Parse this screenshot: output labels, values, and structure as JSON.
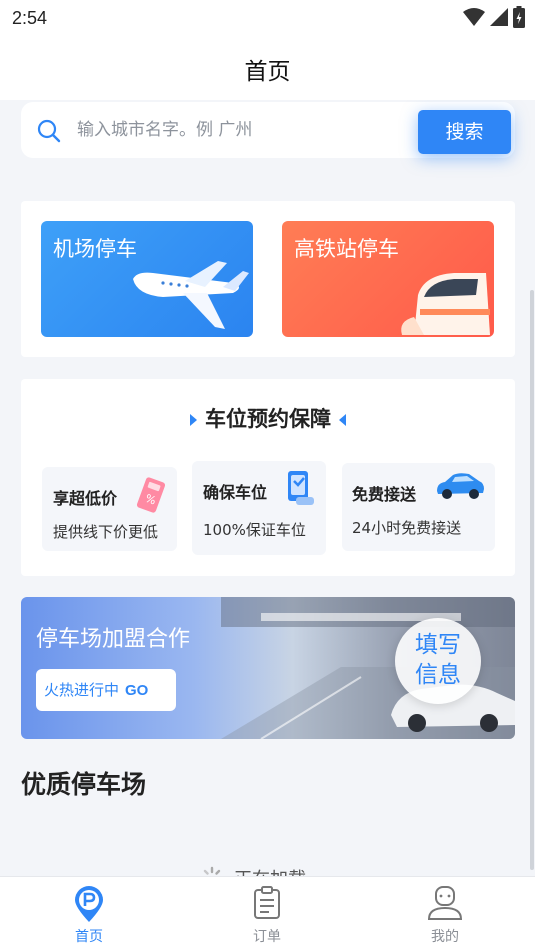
{
  "status_bar": {
    "time": "2:54",
    "icons": [
      "wifi-icon",
      "signal-icon",
      "battery-icon"
    ]
  },
  "header": {
    "title": "首页"
  },
  "search": {
    "placeholder": "输入城市名字。例 广州",
    "button_label": "搜索"
  },
  "services": [
    {
      "label": "机场停车",
      "icon": "airplane-icon",
      "color": "#2f86f6"
    },
    {
      "label": "高铁站停车",
      "icon": "train-icon",
      "color": "#ff6a4f"
    }
  ],
  "promise": {
    "title": "车位预约保障",
    "features": [
      {
        "title": "享超低价",
        "desc": "提供线下价更低",
        "icon": "discount-ticket-icon"
      },
      {
        "title": "确保车位",
        "desc": "100%保证车位",
        "icon": "parking-guarantee-icon"
      },
      {
        "title": "免费接送",
        "desc": "24小时免费接送",
        "icon": "car-icon"
      }
    ]
  },
  "banner": {
    "title": "停车场加盟合作",
    "chip_text": "火热进行中",
    "chip_go": "GO",
    "circle_line1": "填写",
    "circle_line2": "信息"
  },
  "section": {
    "title": "优质停车场"
  },
  "loading": {
    "text": "正在加载"
  },
  "tabs": [
    {
      "label": "首页",
      "icon": "parking-icon",
      "active": true
    },
    {
      "label": "订单",
      "icon": "order-icon",
      "active": false
    },
    {
      "label": "我的",
      "icon": "profile-icon",
      "active": false
    }
  ],
  "colors": {
    "accent": "#2f86f6",
    "rail": "#ff6a4f",
    "background": "#f3f5f9"
  }
}
